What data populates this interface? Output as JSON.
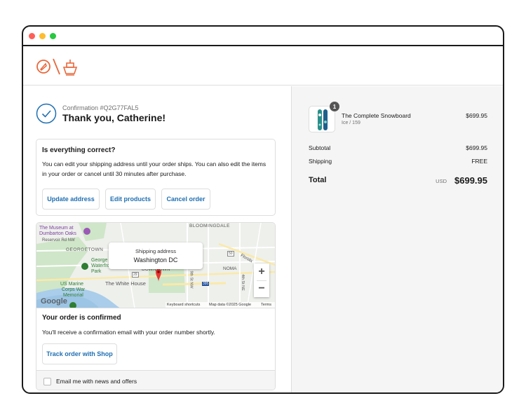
{
  "confirmation": {
    "number": "Confirmation #Q2G77FAL5",
    "thanks": "Thank you, Catherine!"
  },
  "review": {
    "title": "Is everything correct?",
    "text": "You can edit your shipping address until your order ships. You can also edit the items in your order or cancel until 30 minutes after purchase.",
    "buttons": [
      "Update address",
      "Edit products",
      "Cancel order"
    ]
  },
  "map": {
    "bubble_label": "Shipping address",
    "bubble_city": "Washington DC",
    "labels": [
      "The Museum at",
      "Dumbarton Oaks",
      "Reservoir Rd NW",
      "GEORGETOWN",
      "BLOOMINGDALE",
      "NOMA",
      "DOWNTOWN",
      "The White House",
      "US Marine",
      "Corps War",
      "Memorial",
      "George",
      "Waterfront",
      "Park",
      "9th St NW",
      "4th St NE",
      "Florida",
      "Keyboard shortcuts",
      "Map data ©2025 Google",
      "Terms",
      "Google",
      "50",
      "29",
      "395"
    ],
    "zoom_in": "+",
    "zoom_out": "−"
  },
  "order_status": {
    "title": "Your order is confirmed",
    "text": "You'll receive a confirmation email with your order number shortly.",
    "track_button": "Track order with Shop"
  },
  "newsletter": {
    "label": "Email me with news and offers",
    "checked": false
  },
  "summary": {
    "product": {
      "name": "The Complete Snowboard",
      "variant": "Ice / 159",
      "price": "$699.95",
      "quantity": "1"
    },
    "subtotal_label": "Subtotal",
    "subtotal": "$699.95",
    "shipping_label": "Shipping",
    "shipping": "FREE",
    "total_label": "Total",
    "currency": "USD",
    "total": "$699.95"
  },
  "colors": {
    "accent": "#1f6fb2",
    "logo": "#e8683c",
    "window_border": "#1a1a1a"
  }
}
